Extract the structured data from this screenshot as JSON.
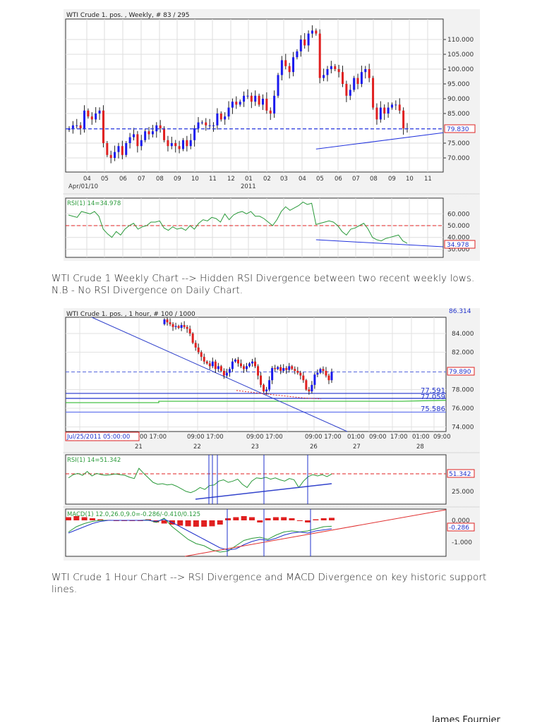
{
  "weekly_chart": {
    "title": "WTI Crude 1. pos. , Weekly, # 83 / 295",
    "price_ticks": [
      "110.000",
      "105.000",
      "100.000",
      "95.000",
      "90.000",
      "85.000",
      "75.000",
      "70.000"
    ],
    "price_tick_values": [
      110,
      105,
      100,
      95,
      90,
      85,
      75,
      70
    ],
    "current_price_label": "79.830",
    "current_price": 79.83,
    "month_labels": [
      "04",
      "05",
      "06",
      "07",
      "08",
      "09",
      "10",
      "11",
      "12",
      "01",
      "02",
      "03",
      "04",
      "05",
      "06",
      "07",
      "08",
      "09",
      "10",
      "11"
    ],
    "start_date_label": "Apr/01/10",
    "year_label": "2011",
    "rsi_label": "RSI(1) 14=34.978",
    "rsi_ticks": [
      "60.000",
      "50.000",
      "40.000",
      "30.000"
    ],
    "rsi_tick_values": [
      60,
      50,
      40,
      30
    ],
    "rsi_current_label": "34.978"
  },
  "caption1_line1": "WTI Crude 1 Weekly Chart --> Hidden RSI Divergence between two recent weekly lows.",
  "caption1_line2": "N.B - No RSI Divergence on Daily Chart.",
  "hourly_chart": {
    "title": "WTI Crude 1. pos. , 1 hour, # 100 / 1000",
    "top_price_label": "86.314",
    "price_ticks": [
      "84.000",
      "82.000",
      "78.000",
      "76.000",
      "74.000"
    ],
    "price_tick_values": [
      84,
      82,
      78,
      76,
      74
    ],
    "current_price_label": "79.890",
    "level_labels": [
      "77.591",
      "77.059",
      "75.586"
    ],
    "level_values": [
      77.591,
      77.059,
      75.586
    ],
    "cursor_time_label": "Jul/25/2011 05:00:00",
    "time_labels": [
      "00 17:00",
      "09:00 17:00",
      "09:00 17:00",
      "09:00 17:00",
      "01:00",
      "09:00",
      "17:00",
      "01:00",
      "09:00"
    ],
    "day_labels": [
      "21",
      "22",
      "23",
      "26",
      "27",
      "28"
    ],
    "rsi_label": "RSI(1) 14=51.342",
    "rsi_current_label": "51.342",
    "rsi_tick": "25.000",
    "macd_label": "MACD(1) 12.0,26.0,9.0=-0.286/-0.410/0.125",
    "macd_ticks": [
      "0.000",
      "-1.000"
    ],
    "macd_current_label": "-0.286"
  },
  "caption2_line1": "WTI Crude 1 Hour Chart --> RSI Divergence and MACD Divergence on key historic support",
  "caption2_line2": "lines.",
  "footer_author": "James Fournier",
  "chart_data": [
    {
      "type": "candlestick",
      "title": "WTI Crude 1. pos. , Weekly",
      "closes": [
        80,
        81,
        81,
        80,
        86,
        84,
        83,
        85,
        86,
        75,
        71,
        70,
        72,
        74,
        71,
        75,
        77,
        78,
        74,
        76,
        79,
        78,
        79,
        81,
        80,
        76,
        74,
        75,
        74,
        73,
        76,
        74,
        76,
        80,
        82,
        82,
        81,
        81,
        81,
        85,
        83,
        84,
        87,
        89,
        88,
        89,
        91,
        91,
        89,
        91,
        88,
        90,
        86,
        85,
        91,
        98,
        103,
        101,
        99,
        104,
        106,
        110,
        108,
        112,
        113,
        112,
        97,
        98,
        100,
        101,
        100,
        99,
        95,
        91,
        93,
        97,
        95,
        99,
        100,
        97,
        87,
        83,
        87,
        85,
        87,
        88,
        88,
        86,
        80,
        80
      ],
      "ylim": [
        66,
        116
      ],
      "horizontal_line": 79.83,
      "trendline": {
        "from_index": 65,
        "from_value": 73,
        "to_value": 78.5
      },
      "rsi": [
        59,
        58,
        57,
        62,
        61,
        60,
        62,
        58,
        47,
        43,
        40,
        45,
        42,
        47,
        50,
        52,
        47,
        49,
        50,
        53,
        53,
        54,
        48,
        46,
        49,
        47,
        48,
        46,
        50,
        47,
        52,
        55,
        54,
        57,
        56,
        53,
        60,
        55,
        59,
        61,
        62,
        60,
        62,
        58,
        58,
        56,
        53,
        50,
        55,
        62,
        66,
        63,
        65,
        67,
        70,
        68,
        69,
        51,
        52,
        53,
        54,
        53,
        50,
        45,
        42,
        47,
        48,
        50,
        52,
        47,
        40,
        38,
        37,
        39,
        40,
        41,
        42,
        37,
        35
      ],
      "rsi_level": 50,
      "rsi_trendline": [
        38,
        32
      ]
    },
    {
      "type": "candlestick",
      "title": "WTI Crude 1. pos. , 1 hour",
      "closes": [
        85.5,
        85.2,
        85,
        84.7,
        84.8,
        84.6,
        84.9,
        84.7,
        84.5,
        84,
        83,
        82.5,
        82,
        81.5,
        81,
        80.8,
        80.5,
        81,
        80.2,
        80.5,
        80,
        79.5,
        79.8,
        80.2,
        81,
        81.2,
        80.8,
        80.5,
        80.2,
        80.5,
        80.8,
        81,
        80.5,
        79.5,
        78.5,
        77.8,
        78,
        79,
        80.3,
        80.2,
        80.4,
        80,
        80.3,
        80.1,
        80.5,
        80.2,
        80,
        79.8,
        79.5,
        79,
        78,
        77.8,
        78.5,
        79.6,
        79.8,
        80.2,
        80,
        79.5,
        79,
        79.9
      ],
      "ylim": [
        73.5,
        85.8
      ],
      "horizontal_line": 79.89,
      "levels": [
        77.591,
        77.059,
        75.586
      ],
      "green_level": 76.8,
      "rsi": [
        45,
        50,
        52,
        49,
        55,
        48,
        52,
        50,
        49,
        50,
        51,
        50,
        49,
        46,
        44,
        60,
        52,
        45,
        38,
        35,
        36,
        34,
        35,
        32,
        28,
        24,
        22,
        25,
        30,
        27,
        33,
        34,
        40,
        42,
        38,
        40,
        43,
        35,
        30,
        40,
        45,
        44,
        46,
        43,
        45,
        42,
        40,
        44,
        42,
        30,
        40,
        47,
        50,
        48,
        50,
        47,
        51
      ],
      "macd_signal": [
        -0.6,
        -0.45,
        -0.3,
        -0.15,
        -0.05,
        0,
        0,
        0,
        0,
        0,
        0,
        -0.05,
        0.05,
        -0.1,
        -0.3,
        -0.5,
        -0.7,
        -0.9,
        -1.1,
        -1.3,
        -1.4,
        -1.35,
        -1.15,
        -1.0,
        -0.9,
        -0.95,
        -0.85,
        -0.7,
        -0.6,
        -0.55,
        -0.6,
        -0.5,
        -0.45,
        -0.4
      ],
      "macd_line": [
        -0.55,
        -0.3,
        -0.15,
        -0.05,
        0,
        0,
        0,
        0,
        0,
        0,
        0.02,
        -0.1,
        0.1,
        -0.3,
        -0.6,
        -0.9,
        -1.1,
        -1.2,
        -1.4,
        -1.5,
        -1.45,
        -1.2,
        -0.95,
        -0.85,
        -0.8,
        -0.9,
        -0.7,
        -0.55,
        -0.5,
        -0.55,
        -0.5,
        -0.4,
        -0.3,
        -0.28
      ],
      "macd_hist": [
        0.15,
        0.2,
        0.15,
        0.1,
        0.05,
        0.02,
        0,
        0,
        0,
        0,
        0.05,
        -0.1,
        -0.15,
        -0.2,
        -0.25,
        -0.28,
        -0.3,
        -0.3,
        -0.28,
        -0.2,
        0.1,
        0.15,
        0.2,
        0.15,
        -0.1,
        0.1,
        0.15,
        0.15,
        0.1,
        0,
        -0.1,
        0.05,
        0.1,
        0.12
      ]
    }
  ]
}
